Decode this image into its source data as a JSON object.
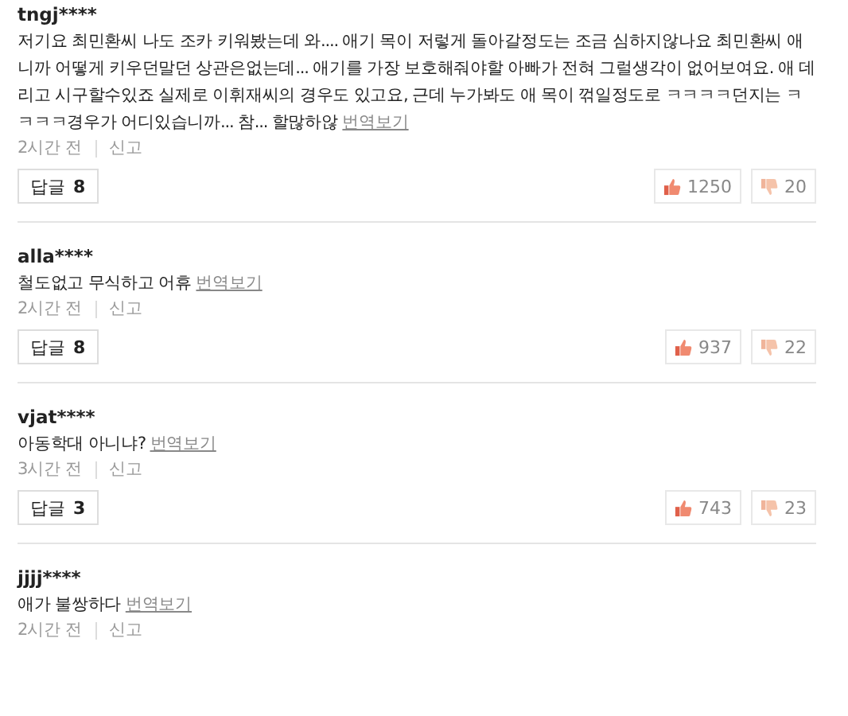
{
  "comments": [
    {
      "user": "tngj****",
      "text": "저기요 최민환씨 나도 조카 키워봤는데 와.... 애기 목이 저렇게 돌아갈정도는 조금 심하지않나요 최민환씨 애니까 어떻게 키우던말던 상관은없는데... 애기를 가장 보호해줘야할 아빠가 전혀 그럴생각이 없어보여요. 애 데리고 시구할수있죠 실제로 이휘재씨의 경우도 있고요, 근데 누가봐도 애 목이 꺾일정도로 ㅋㅋㅋㅋ던지는 ㅋㅋㅋㅋ경우가 어디있습니까... 참... 할많하않",
      "translate": "번역보기",
      "time": "2시간 전",
      "report": "신고",
      "reply_label": "답글",
      "reply_count": "8",
      "likes": "1250",
      "dislikes": "20"
    },
    {
      "user": "alla****",
      "text": "철도없고 무식하고 어휴",
      "translate": "번역보기",
      "time": "2시간 전",
      "report": "신고",
      "reply_label": "답글",
      "reply_count": "8",
      "likes": "937",
      "dislikes": "22"
    },
    {
      "user": "vjat****",
      "text": "아동학대 아니냐?",
      "translate": "번역보기",
      "time": "3시간 전",
      "report": "신고",
      "reply_label": "답글",
      "reply_count": "3",
      "likes": "743",
      "dislikes": "23"
    },
    {
      "user": "jjjj****",
      "text": "애가 불쌍하다",
      "translate": "번역보기",
      "time": "2시간 전",
      "report": "신고"
    }
  ]
}
